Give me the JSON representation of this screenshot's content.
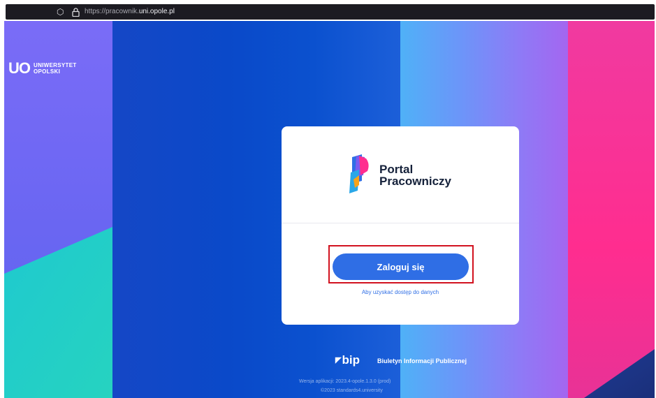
{
  "browser": {
    "url_prefix": "https://pracownik.",
    "url_host": "uni.opole.pl",
    "shield_icon": "shield-icon",
    "lock_icon": "lock-icon"
  },
  "university": {
    "logo_mark": "UO",
    "name_line1": "UNIWERSYTET",
    "name_line2": "OPOLSKI"
  },
  "card": {
    "app_title_line1": "Portal",
    "app_title_line2": "Pracowniczy",
    "login_button": "Zaloguj się",
    "login_hint": "Aby uzyskać dostęp do danych"
  },
  "footer": {
    "bip_logo": "bip",
    "bip_text": "Biuletyn Informacji Publicznej",
    "version": "Wersja aplikacji: 2023.4-opole.1.3.0 (prod)",
    "copyright": "©2023 standards4.university"
  },
  "colors": {
    "accent": "#2f6ee5",
    "highlight": "#d2121f",
    "pink": "#ff2d8f",
    "teal": "#1ec8c8"
  }
}
